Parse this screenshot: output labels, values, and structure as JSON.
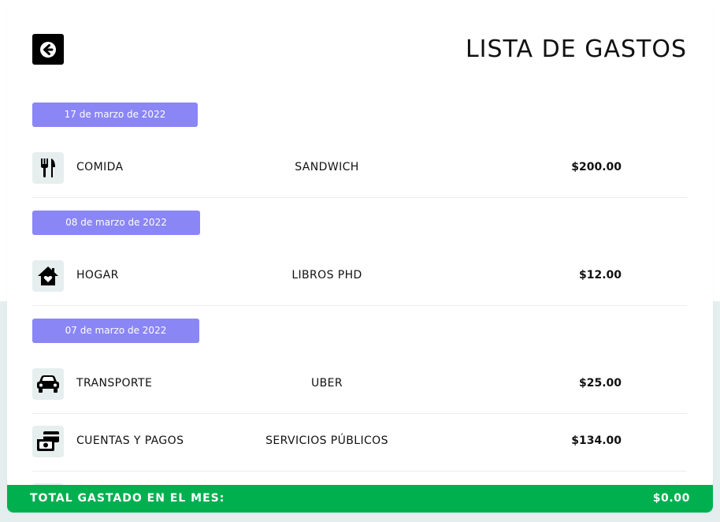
{
  "header": {
    "title": "LISTA DE GASTOS",
    "back_icon": "arrow-left-icon"
  },
  "groups": [
    {
      "date": "17 de marzo de 2022",
      "items": [
        {
          "icon": "fork-knife-icon",
          "category": "COMIDA",
          "description": "SANDWICH",
          "amount": "$200.00"
        }
      ]
    },
    {
      "date": "08 de marzo de 2022",
      "items": [
        {
          "icon": "house-heart-icon",
          "category": "HOGAR",
          "description": "LIBROS PHD",
          "amount": "$12.00"
        }
      ]
    },
    {
      "date": "07 de marzo de 2022",
      "items": [
        {
          "icon": "car-icon",
          "category": "TRANSPORTE",
          "description": "UBER",
          "amount": "$25.00"
        },
        {
          "icon": "money-cards-icon",
          "category": "CUENTAS Y PAGOS",
          "description": "SERVICIOS PÚBLICOS",
          "amount": "$134.00"
        }
      ]
    }
  ],
  "footer": {
    "total_label": "TOTAL GASTADO EN EL MES:",
    "total_value": "$0.00"
  },
  "colors": {
    "date_chip": "#8a86f5",
    "total_bar": "#00b04f",
    "icon_bg": "#e6eeee"
  }
}
